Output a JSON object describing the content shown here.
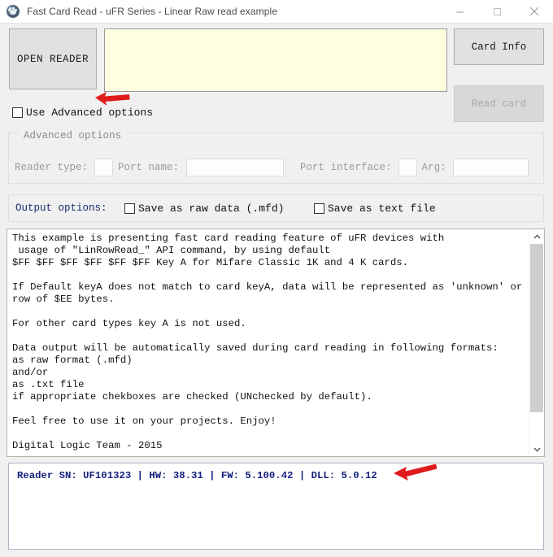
{
  "window": {
    "title": "Fast Card Read - uFR Series - Linear Raw read example",
    "icon": "app-paw-icon",
    "controls": {
      "minimize": "minimize-icon",
      "maximize": "maximize-icon",
      "close": "close-icon"
    }
  },
  "toolbar": {
    "open_reader_label": "OPEN READER",
    "card_info_label": "Card Info",
    "read_card_label": "Read card",
    "read_card_enabled": false,
    "info_box_value": "",
    "info_box_color": "#ffffe0"
  },
  "advanced": {
    "use_advanced_label": "Use Advanced options",
    "use_advanced_checked": false,
    "group_title": "Advanced options",
    "reader_type_label": "Reader type:",
    "reader_type_value": "",
    "port_name_label": "Port name:",
    "port_name_value": "",
    "port_interface_label": "Port interface:",
    "port_interface_value": "",
    "arg_label": "Arg:",
    "arg_value": "",
    "disabled": true
  },
  "output_options": {
    "label": "Output options:",
    "label_color": "#1b2a6b",
    "save_raw_label": "Save as raw data (.mfd)",
    "save_raw_checked": false,
    "save_text_label": "Save as text file",
    "save_text_checked": false
  },
  "log": {
    "content": "This example is presenting fast card reading feature of uFR devices with\n usage of \"LinRowRead_\" API command, by using default\n$FF $FF $FF $FF $FF $FF Key A for Mifare Classic 1K and 4 K cards.\n\nIf Default keyA does not match to card keyA, data will be represented as 'unknown' or as\nrow of $EE bytes.\n\nFor other card types key A is not used.\n\nData output will be automatically saved during card reading in following formats:\nas raw format (.mfd)\nand/or\nas .txt file\nif appropriate chekboxes are checked (UNchecked by default).\n\nFeel free to use it on your projects. Enjoy!\n\nDigital Logic Team - 2015",
    "scroll_up_icon": "chevron-up-icon",
    "scroll_down_icon": "chevron-down-icon"
  },
  "status": {
    "text": "Reader SN: UF101323 | HW: 38.31 | FW: 5.100.42 | DLL: 5.0.12",
    "color": "#141f7d"
  },
  "annotations": {
    "arrow_color": "#e01b1b",
    "arrow_advanced": "red-arrow-icon",
    "arrow_status": "red-arrow-icon"
  }
}
